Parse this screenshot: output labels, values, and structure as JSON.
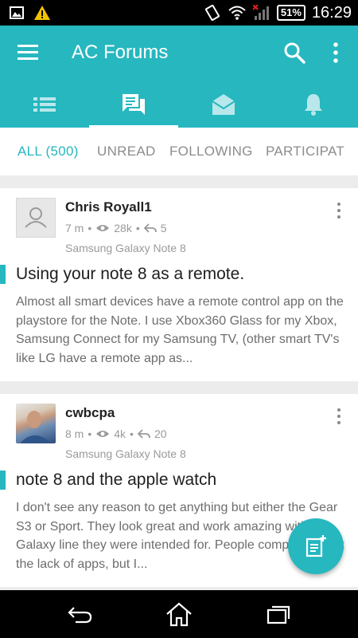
{
  "status_bar": {
    "battery": "51%",
    "time": "16:29"
  },
  "app_bar": {
    "title": "AC Forums"
  },
  "tabs": [
    "list",
    "topics",
    "messages",
    "notifications"
  ],
  "filters": {
    "all": "ALL (500)",
    "unread": "UNREAD",
    "following": "FOLLOWING",
    "participating": "PARTICIPAT"
  },
  "posts": [
    {
      "author": "Chris Royall1",
      "age": "7 m",
      "views": "28k",
      "replies": "5",
      "forum": "Samsung Galaxy Note 8",
      "title": "Using your note 8 as a remote.",
      "excerpt": "Almost all smart devices have a remote control app on the playstore for the Note. I use Xbox360 Glass for my Xbox, Samsung Connect for my Samsung TV, (other smart TV's like LG have a remote app as..."
    },
    {
      "author": "cwbcpa",
      "age": "8 m",
      "views": "4k",
      "replies": "20",
      "forum": "Samsung Galaxy Note 8",
      "title": "note 8 and the apple watch",
      "excerpt": "I don't see any reason to get anything but either the Gear S3 or Sport. They look great and work amazing with the Galaxy line they were intended for. People complain about the lack of apps, but I..."
    }
  ],
  "colors": {
    "accent": "#26b7bf",
    "status_bar": "#000000"
  }
}
